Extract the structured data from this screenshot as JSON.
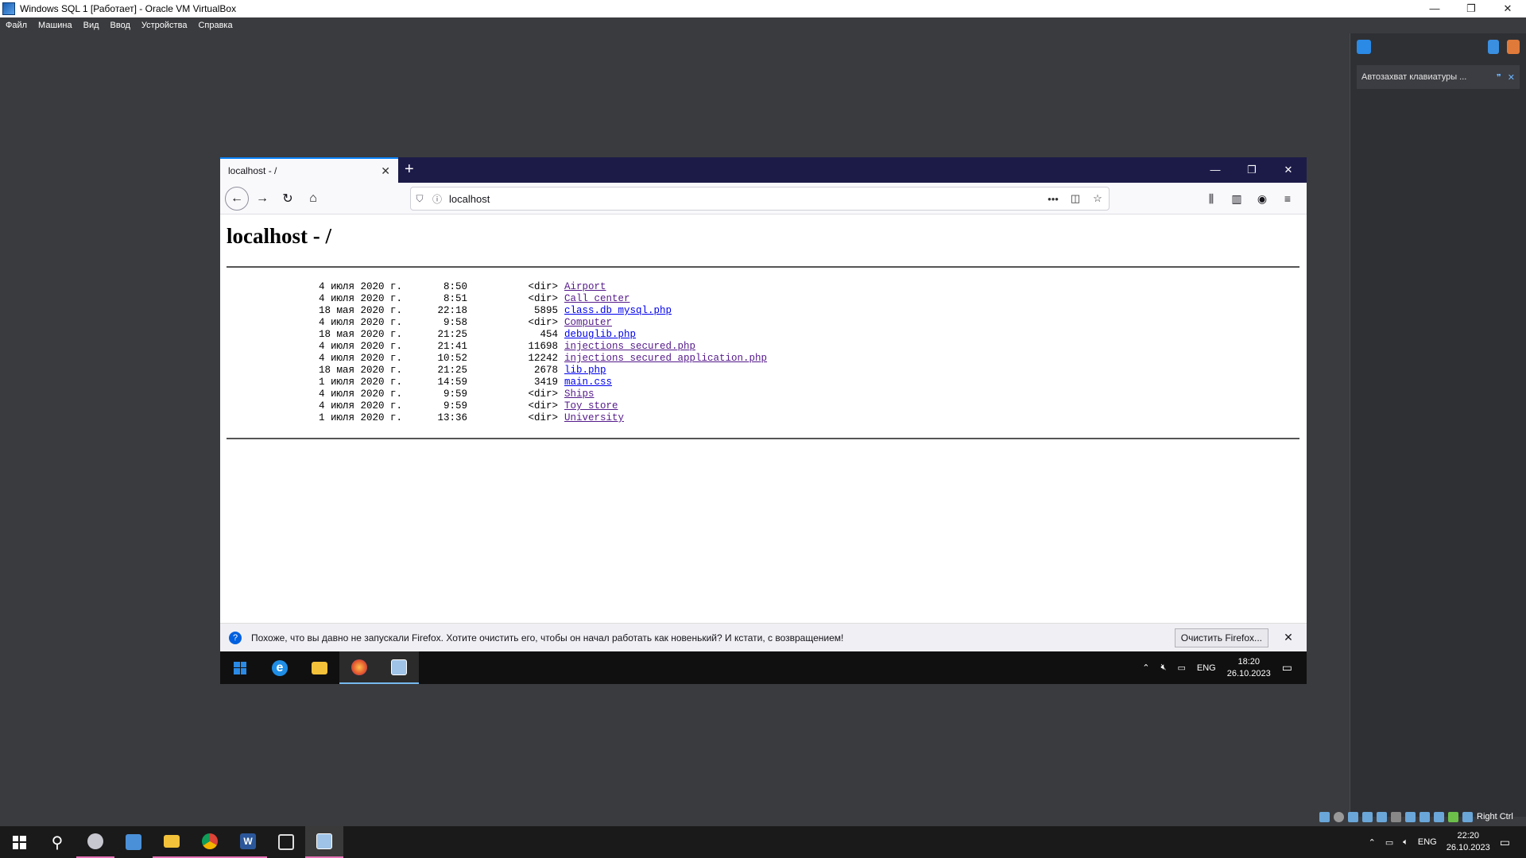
{
  "host": {
    "window_title": "Windows SQL 1 [Работает] - Oracle VM VirtualBox",
    "menu": [
      "Файл",
      "Машина",
      "Вид",
      "Ввод",
      "Устройства",
      "Справка"
    ],
    "side_notice": "Автозахват клавиатуры ...",
    "status_right": "Right Ctrl",
    "taskbar": {
      "lang": "ENG",
      "time": "22:20",
      "date": "26.10.2023"
    }
  },
  "firefox": {
    "tab_title": "localhost - /",
    "url": "localhost",
    "page_heading": "localhost - /",
    "listing": [
      {
        "date": "4 июля 2020 г.",
        "time": "8:50",
        "size": "<dir>",
        "name": "Airport"
      },
      {
        "date": "4 июля 2020 г.",
        "time": "8:51",
        "size": "<dir>",
        "name": "Call center"
      },
      {
        "date": "18 мая 2020 г.",
        "time": "22:18",
        "size": "5895",
        "name": "class.db_mysql.php"
      },
      {
        "date": "4 июля 2020 г.",
        "time": "9:58",
        "size": "<dir>",
        "name": "Computer"
      },
      {
        "date": "18 мая 2020 г.",
        "time": "21:25",
        "size": "454",
        "name": "debuglib.php"
      },
      {
        "date": "4 июля 2020 г.",
        "time": "21:41",
        "size": "11698",
        "name": "injections_secured.php"
      },
      {
        "date": "4 июля 2020 г.",
        "time": "10:52",
        "size": "12242",
        "name": "injections_secured_application.php"
      },
      {
        "date": "18 мая 2020 г.",
        "time": "21:25",
        "size": "2678",
        "name": "lib.php"
      },
      {
        "date": "1 июля 2020 г.",
        "time": "14:59",
        "size": "3419",
        "name": "main.css"
      },
      {
        "date": "4 июля 2020 г.",
        "time": "9:59",
        "size": "<dir>",
        "name": "Ships"
      },
      {
        "date": "4 июля 2020 г.",
        "time": "9:59",
        "size": "<dir>",
        "name": "Toy store"
      },
      {
        "date": "1 июля 2020 г.",
        "time": "13:36",
        "size": "<dir>",
        "name": "University"
      }
    ],
    "notification": {
      "text": "Похоже, что вы давно не запускали Firefox. Хотите очистить его, чтобы он начал работать как новенький? И кстати, с возвращением!",
      "button": "Очистить Firefox..."
    }
  },
  "guest_taskbar": {
    "lang": "ENG",
    "time": "18:20",
    "date": "26.10.2023"
  },
  "colors": {
    "tabbar": "#1c1b48",
    "visited_link": "#551a8b",
    "link": "#0000ee",
    "host_bg": "#3a3b3e"
  }
}
